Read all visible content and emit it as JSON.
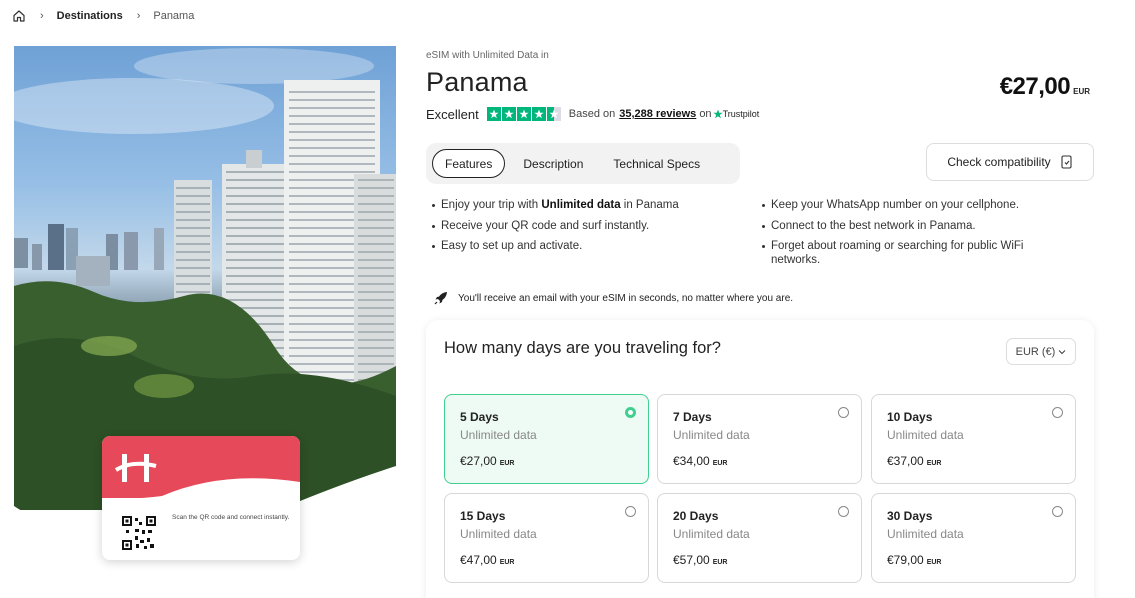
{
  "breadcrumb": {
    "home_icon": "home-icon",
    "items": [
      "Destinations",
      "Panama"
    ]
  },
  "hero": {
    "sim_card_text": "Scan the QR code and connect instantly.",
    "brand_color": "#e64a5a"
  },
  "product": {
    "subtitle": "eSIM with Unlimited Data in",
    "title": "Panama",
    "price": "€27,00",
    "price_currency": "EUR"
  },
  "rating": {
    "label": "Excellent",
    "stars": 4.5,
    "based_on": "Based on",
    "reviews": "35,288 reviews",
    "on": "on",
    "provider": "Trustpilot"
  },
  "tabs": [
    {
      "label": "Features",
      "active": true
    },
    {
      "label": "Description",
      "active": false
    },
    {
      "label": "Technical Specs",
      "active": false
    }
  ],
  "compat_button": {
    "label": "Check compatibility"
  },
  "features": {
    "left": [
      {
        "pre": "Enjoy your trip with ",
        "bold": "Unlimited data",
        "post": " in Panama"
      },
      {
        "pre": "Receive your QR code and surf instantly.",
        "bold": "",
        "post": ""
      },
      {
        "pre": "Easy to set up and activate.",
        "bold": "",
        "post": ""
      }
    ],
    "right": [
      "Keep your WhatsApp number on your cellphone.",
      "Connect to the best network in Panama.",
      "Forget about roaming or searching for public WiFi networks."
    ]
  },
  "email_note": "You'll receive an email with your eSIM in seconds, no matter where you are.",
  "days_panel": {
    "question": "How many days are you traveling for?",
    "currency_select": "EUR (€)",
    "plans": [
      {
        "days": "5 Days",
        "data": "Unlimited data",
        "price": "€27,00",
        "cur": "EUR",
        "selected": true
      },
      {
        "days": "7 Days",
        "data": "Unlimited data",
        "price": "€34,00",
        "cur": "EUR",
        "selected": false
      },
      {
        "days": "10 Days",
        "data": "Unlimited data",
        "price": "€37,00",
        "cur": "EUR",
        "selected": false
      },
      {
        "days": "15 Days",
        "data": "Unlimited data",
        "price": "€47,00",
        "cur": "EUR",
        "selected": false
      },
      {
        "days": "20 Days",
        "data": "Unlimited data",
        "price": "€57,00",
        "cur": "EUR",
        "selected": false
      },
      {
        "days": "30 Days",
        "data": "Unlimited data",
        "price": "€79,00",
        "cur": "EUR",
        "selected": false
      }
    ]
  },
  "colors": {
    "accent_green": "#3fcf8e",
    "trustpilot_green": "#00b67a"
  }
}
